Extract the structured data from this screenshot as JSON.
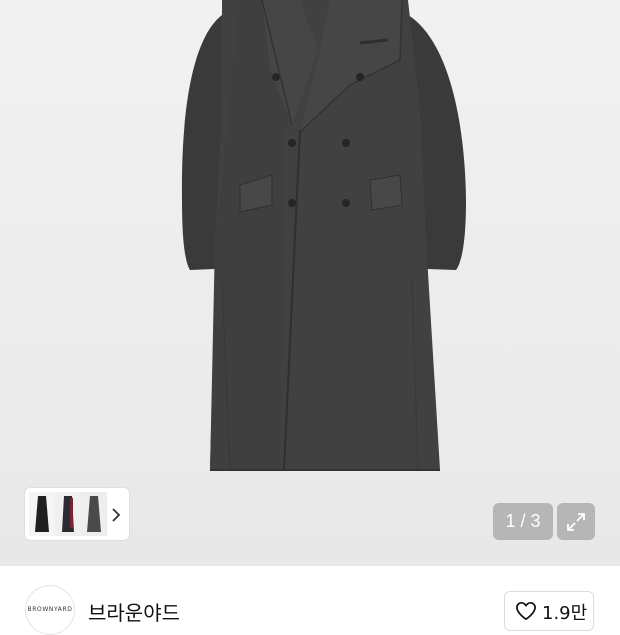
{
  "gallery": {
    "current_page": 1,
    "total_pages": 3,
    "indicator_text": "1 / 3",
    "thumbnail_count": 3,
    "icons": {
      "next": "chevron-right-icon",
      "expand": "expand-arrows-icon"
    }
  },
  "brand": {
    "logo_text": "BROWNYARD",
    "name": "브라운야드"
  },
  "like": {
    "count_label": "1.9만",
    "icon": "heart-outline-icon"
  },
  "colors": {
    "coat": "#3e3e3f",
    "background": "#eeeeef",
    "overlay": "#969696"
  }
}
